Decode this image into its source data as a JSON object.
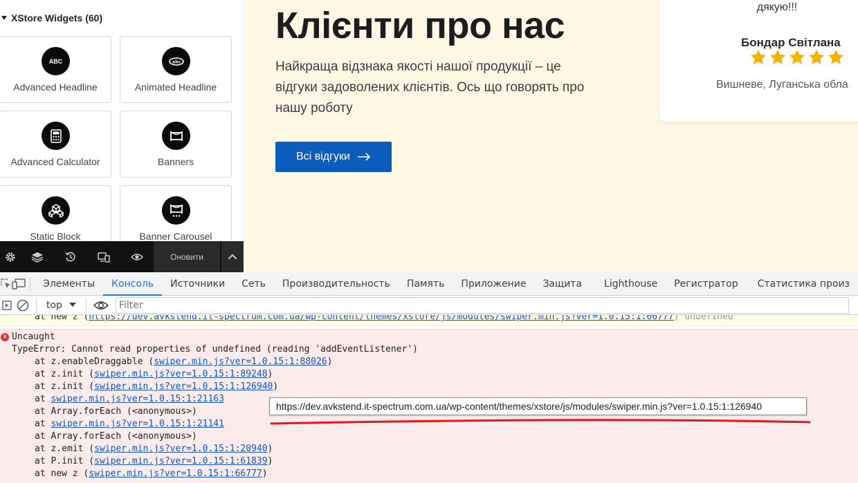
{
  "panel": {
    "category_title": "XStore Widgets (60)",
    "widgets": [
      {
        "label": "Advanced Headline",
        "icon_text": "ABC"
      },
      {
        "label": "Animated Headline",
        "icon_text": "abc"
      },
      {
        "label": "Advanced Calculator",
        "icon_text": ""
      },
      {
        "label": "Banners",
        "icon_text": ""
      },
      {
        "label": "Static Block",
        "icon_text": ""
      },
      {
        "label": "Banner Carousel",
        "icon_text": ""
      }
    ],
    "footer": {
      "update_label": "Оновити"
    }
  },
  "preview": {
    "title": "Клієнти про нас",
    "text": "Найкраща відзнака якості нашої продукції – це відгуки задоволених клієнтів. Ось що говорять про нашу роботу",
    "button_label": "Всі відгуки",
    "review": {
      "text_tail": "дякую!!!",
      "name": "Бондар Світлана",
      "rating": 5,
      "location": "Вишневе, Луганська обла"
    },
    "colors": {
      "background": "#fef8e4",
      "button": "#0b5cbd",
      "star": "#f5b301"
    }
  },
  "devtools": {
    "tabs": [
      "Элементы",
      "Консоль",
      "Источники",
      "Сеть",
      "Производительность",
      "Память",
      "Приложение",
      "Защита",
      "Lighthouse",
      "Регистратор",
      "Статистика произ"
    ],
    "active_tab": "Консоль",
    "context": "top",
    "filter_placeholder": "Filter",
    "warning_line": {
      "prefix": "at new z (",
      "link": "https://dev.avkstend.it-spectrum.com.ua/wp-content/themes/xstore/js/modules/swiper.min.js?ver=1.0.15:1:66777",
      "suffix": ") undefined"
    },
    "error": {
      "header": "Uncaught",
      "message": "TypeError: Cannot read properties of undefined (reading 'addEventListener')",
      "stack": [
        {
          "pre": "at z.enableDraggable (",
          "link": "swiper.min.js?ver=1.0.15:1:88026",
          "post": ")"
        },
        {
          "pre": "at z.init (",
          "link": "swiper.min.js?ver=1.0.15:1:89248",
          "post": ")"
        },
        {
          "pre": "at z.init (",
          "link": "swiper.min.js?ver=1.0.15:1:126940",
          "post": ")"
        },
        {
          "pre": "at ",
          "link": "swiper.min.js?ver=1.0.15:1:21163",
          "post": ""
        },
        {
          "pre": "at Array.forEach (<anonymous>)",
          "link": "",
          "post": ""
        },
        {
          "pre": "at ",
          "link": "swiper.min.js?ver=1.0.15:1:21141",
          "post": ""
        },
        {
          "pre": "at Array.forEach (<anonymous>)",
          "link": "",
          "post": ""
        },
        {
          "pre": "at z.emit (",
          "link": "swiper.min.js?ver=1.0.15:1:20940",
          "post": ")"
        },
        {
          "pre": "at P.init (",
          "link": "swiper.min.js?ver=1.0.15:1:61839",
          "post": ")"
        },
        {
          "pre": "at new z (",
          "link": "swiper.min.js?ver=1.0.15:1:66777",
          "post": ")"
        }
      ]
    },
    "tooltip": "https://dev.avkstend.it-spectrum.com.ua/wp-content/themes/xstore/js/modules/swiper.min.js?ver=1.0.15:1:126940"
  }
}
